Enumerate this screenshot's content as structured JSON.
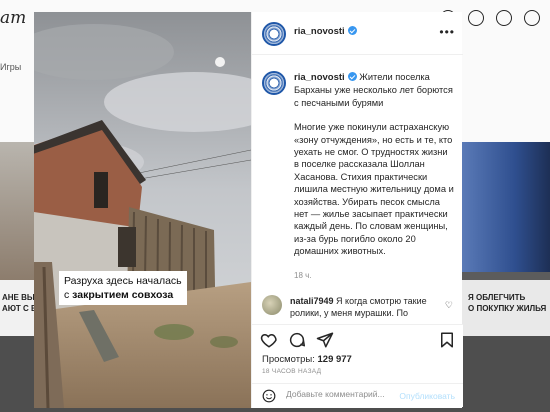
{
  "background": {
    "logo": "am",
    "games_label": "Игры",
    "left_ad": "АНЕ ВЫГОДНЫЕ\nАЮТ С ВЫГОДО",
    "right_ad": "Я ОБЛЕГЧИТЬ\nО ПОКУПКУ ЖИЛЬЯ"
  },
  "post": {
    "username": "ria_novosti",
    "more_icon": "more-horizontal-icon",
    "caption_line1": "Разруха здесь началась",
    "caption_line2_prefix": "с ",
    "caption_line2_bold": "закрытием совхоза",
    "paragraph1": "Жители поселка Барханы уже несколько лет борются с песчаными бурями",
    "paragraph2": "Многие уже покинули астраханскую «зону отчуждения», но есть и те, кто уехать не смог. О трудностях жизни в поселке рассказала Шоллан Хасанова. Стихия практически лишила местную жительницу дома и хозяйства. Убирать песок смысла нет — жилье засыпает практически каждый день. По словам женщины, из-за бурь погибло около 20 домашних животных.",
    "timestamp": "18 ч."
  },
  "comment": {
    "username": "natali7949",
    "text": "Я когда смотрю такие ролики, у меня мурашки. По"
  },
  "actions": {
    "views_label": "Просмотры:",
    "views_count": "129 977",
    "time_ago": "18 ЧАСОВ НАЗАД",
    "add_comment_placeholder": "Добавьте комментарий...",
    "publish_label": "Опубликовать"
  },
  "colors": {
    "accent": "#3897f0",
    "publish_disabled": "#b2dffc",
    "brand_ring": "#1f57a8"
  }
}
